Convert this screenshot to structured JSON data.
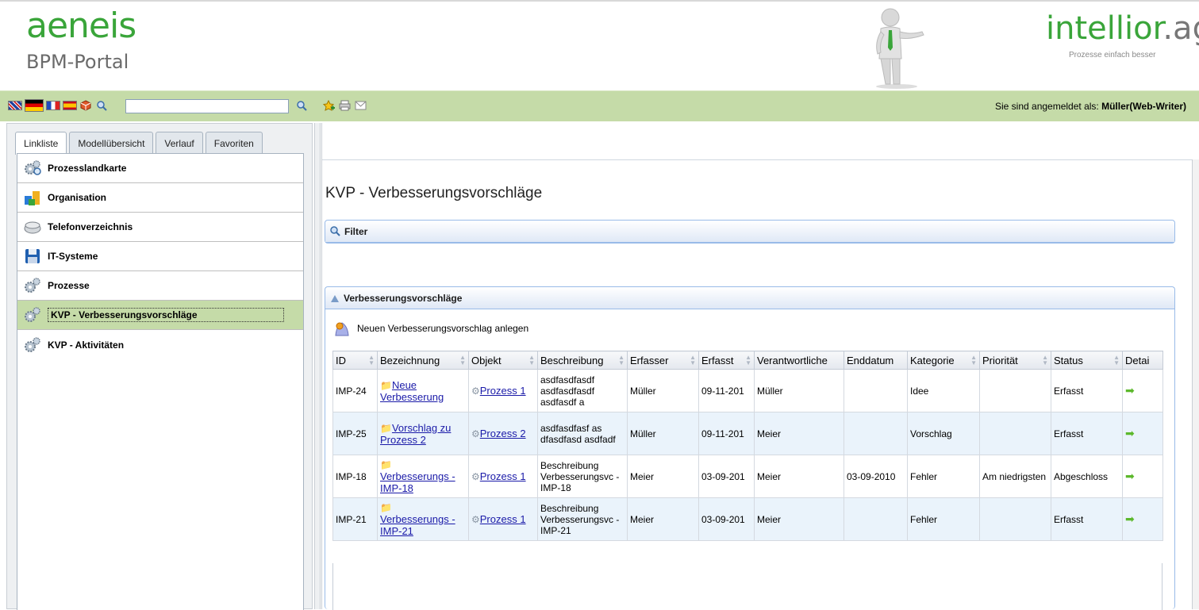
{
  "header": {
    "brand": "aeneis",
    "brand_sub": "BPM-Portal",
    "vendor": "intellior",
    "vendor_suffix": ".ag",
    "vendor_tagline": "Prozesse einfach besser"
  },
  "toolbar": {
    "search_value": "",
    "login_prefix": "Sie sind angemeldet als: ",
    "login_user": "Müller(Web-Writer)"
  },
  "tabs": [
    {
      "label": "Linkliste",
      "active": true
    },
    {
      "label": "Modellübersicht"
    },
    {
      "label": "Verlauf"
    },
    {
      "label": "Favoriten"
    }
  ],
  "nav": [
    {
      "label": "Prozesslandkarte",
      "icon": "gears-search-icon"
    },
    {
      "label": "Organisation",
      "icon": "organisation-icon"
    },
    {
      "label": "Telefonverzeichnis",
      "icon": "phone-icon"
    },
    {
      "label": "IT-Systeme",
      "icon": "floppy-icon"
    },
    {
      "label": "Prozesse",
      "icon": "gears-icon"
    },
    {
      "label": "KVP - Verbesserungsvorschläge",
      "icon": "gears-icon",
      "selected": true
    },
    {
      "label": "KVP - Aktivitäten",
      "icon": "gears-icon"
    }
  ],
  "main": {
    "title": "KVP - Verbesserungsvorschläge",
    "filter_label": "Filter",
    "panel_label": "Verbesserungsvorschläge",
    "new_label": "Neuen Verbesserungsvorschlag anlegen"
  },
  "table": {
    "columns": [
      "ID",
      "Bezeichnung",
      "Objekt",
      "Beschreibung",
      "Erfasser",
      "Erfasst",
      "Verantwortliche",
      "Enddatum",
      "Kategorie",
      "Priorität",
      "Status",
      "Detai"
    ],
    "rows": [
      {
        "id": "IMP-24",
        "bez": "Neue Verbesserung",
        "obj": "Prozess 1",
        "beschr": "asdfasdfasdf asdfasdfasdf asdfasdf a",
        "erfasser": "Müller",
        "erfasst": "09-11-201",
        "verant": "Müller",
        "ende": "",
        "kat": "Idee",
        "prio": "",
        "status": "Erfasst"
      },
      {
        "id": "IMP-25",
        "bez": "Vorschlag zu Prozess 2",
        "obj": "Prozess 2",
        "beschr": "asdfasdfasf as dfasdfasd asdfadf",
        "erfasser": "Müller",
        "erfasst": "09-11-201",
        "verant": "Meier",
        "ende": "",
        "kat": "Vorschlag",
        "prio": "",
        "status": "Erfasst"
      },
      {
        "id": "IMP-18",
        "bez": "Verbesserungs - IMP-18",
        "obj": "Prozess 1",
        "beschr": "Beschreibung Verbesserungsvc - IMP-18",
        "erfasser": "Meier",
        "erfasst": "03-09-201",
        "verant": "Meier",
        "ende": "03-09-2010",
        "kat": "Fehler",
        "prio": "Am niedrigsten",
        "status": "Abgeschloss"
      },
      {
        "id": "IMP-21",
        "bez": "Verbesserungs - IMP-21",
        "obj": "Prozess 1",
        "beschr": "Beschreibung Verbesserungsvc - IMP-21",
        "erfasser": "Meier",
        "erfasst": "03-09-201",
        "verant": "Meier",
        "ende": "",
        "kat": "Fehler",
        "prio": "",
        "status": "Erfasst"
      }
    ]
  },
  "colors": {
    "brand_green": "#3aa53a",
    "toolbar_bg": "#c5dba8",
    "panel_border": "#99bbe8",
    "link": "#1a1aa8"
  }
}
